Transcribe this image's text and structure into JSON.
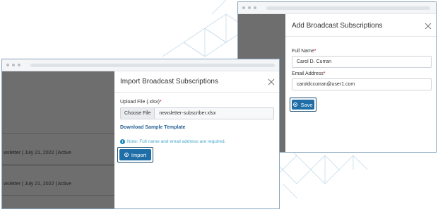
{
  "subscriptions_window": {
    "rows": [
      {
        "text": "wsletter  |  July 21, 2022  |  Active"
      },
      {
        "text": "wsletter  |  July 21, 2022  |  Active"
      }
    ],
    "modal": {
      "title": "Import Broadcast Subscriptions",
      "upload_label": "Upload File (.xlsx)",
      "required_mark": "*",
      "choose_file_label": "Choose File",
      "file_name": "newsletter-subscriber.xlsx",
      "download_link": "Download Sample Template",
      "note_icon": "info-icon",
      "note": "Note: Full name and email address are required.",
      "import_label": "Import"
    }
  },
  "add_window": {
    "modal": {
      "title": "Add Broadcast Subscriptions",
      "full_name_label": "Full Name",
      "full_name_value": "Carol D. Curran",
      "email_label": "Email Address",
      "email_value": "caroldccurran@user1.com",
      "required_mark": "*",
      "save_label": "Save"
    }
  },
  "colors": {
    "primary": "#1f6ea8",
    "required": "#d0021b",
    "link": "#2a6496",
    "note": "#4aa9cc",
    "overlay": "#6e6e6e",
    "decor": "#b8d4e3"
  },
  "icons": [
    "close-icon",
    "info-icon",
    "import-icon",
    "save-icon"
  ]
}
